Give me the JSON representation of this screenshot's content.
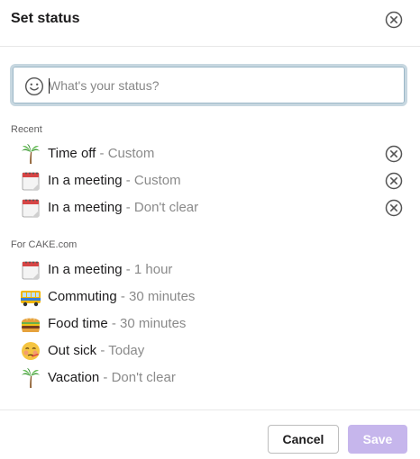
{
  "dialog": {
    "title": "Set status",
    "close_icon": "close-circle-icon"
  },
  "input": {
    "placeholder": "What's your status?",
    "value": "",
    "emoji_icon": "smiley-face-icon"
  },
  "recent": {
    "label": "Recent",
    "items": [
      {
        "emoji": "palm-tree-icon",
        "main": "Time off",
        "sub": " - Custom"
      },
      {
        "emoji": "calendar-icon",
        "main": "In a meeting",
        "sub": " - Custom"
      },
      {
        "emoji": "calendar-icon",
        "main": "In a meeting",
        "sub": " - Don't clear"
      }
    ]
  },
  "workspace": {
    "label": "For CAKE.com",
    "items": [
      {
        "emoji": "calendar-icon",
        "main": "In a meeting",
        "sub": " - 1 hour"
      },
      {
        "emoji": "bus-icon",
        "main": "Commuting",
        "sub": " - 30 minutes"
      },
      {
        "emoji": "burger-icon",
        "main": "Food time",
        "sub": " - 30 minutes"
      },
      {
        "emoji": "sick-face-icon",
        "main": "Out sick",
        "sub": " - Today"
      },
      {
        "emoji": "palm-tree-icon",
        "main": "Vacation",
        "sub": " - Don't clear"
      }
    ]
  },
  "footer": {
    "cancel_label": "Cancel",
    "save_label": "Save"
  },
  "colors": {
    "save_disabled": "#c6b6ec",
    "input_focus_ring": "#c7d7e0",
    "muted_text": "#8a8a8a"
  }
}
